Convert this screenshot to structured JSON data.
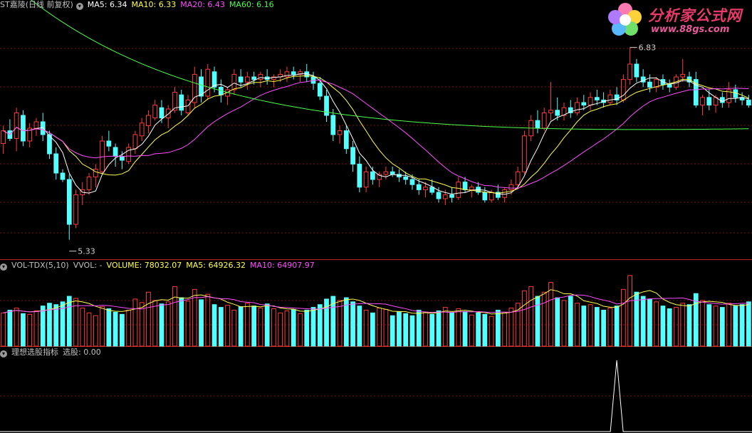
{
  "main_header": {
    "title": "ST嘉陵(日线 前复权)",
    "ma5": "MA5: 6.34",
    "ma10": "MA10: 6.33",
    "ma20": "MA20: 6.43",
    "ma60": "MA60: 6.16"
  },
  "vol_header": {
    "name": "VOL-TDX(5,10)",
    "vvol": "VVOL: -",
    "volume": "VOLUME: 78032.07",
    "ma5": "MA5: 64926.32",
    "ma10": "MA10: 64907.97"
  },
  "ind_header": {
    "name": "理想选股指标",
    "value": "选股: 0.00"
  },
  "logo": {
    "text": "分析家公式网",
    "url": "www.88gs.com"
  },
  "colors": {
    "up": "#ff3b3b",
    "down": "#54ffff",
    "ma5": "#ffffff",
    "ma10": "#ffff4a",
    "ma20": "#ff4dff",
    "ma60": "#4aff4a",
    "grid": "#7a1414",
    "divider": "#c02020"
  },
  "chart_data": {
    "type": "candlestick",
    "price_range": [
      5.2,
      7.1
    ],
    "high_label": "6.83",
    "low_label": "5.33",
    "ohlc": [
      [
        6.08,
        6.22,
        6.0,
        6.18
      ],
      [
        6.18,
        6.27,
        6.1,
        6.12
      ],
      [
        6.12,
        6.36,
        6.02,
        6.32
      ],
      [
        6.3,
        6.34,
        6.06,
        6.1
      ],
      [
        6.1,
        6.24,
        6.05,
        6.2
      ],
      [
        6.2,
        6.28,
        6.14,
        6.25
      ],
      [
        6.25,
        6.32,
        6.1,
        6.15
      ],
      [
        6.15,
        6.18,
        5.96,
        6.0
      ],
      [
        6.0,
        6.05,
        5.8,
        5.85
      ],
      [
        5.85,
        5.88,
        5.78,
        5.8
      ],
      [
        5.8,
        5.84,
        5.33,
        5.45
      ],
      [
        5.45,
        5.72,
        5.42,
        5.68
      ],
      [
        5.68,
        5.78,
        5.6,
        5.72
      ],
      [
        5.72,
        5.85,
        5.68,
        5.82
      ],
      [
        5.82,
        5.92,
        5.74,
        5.88
      ],
      [
        5.86,
        6.14,
        5.84,
        6.1
      ],
      [
        6.1,
        6.18,
        6.02,
        6.06
      ],
      [
        6.05,
        6.08,
        5.9,
        5.98
      ],
      [
        5.98,
        6.02,
        5.88,
        5.95
      ],
      [
        5.94,
        6.08,
        5.92,
        6.05
      ],
      [
        6.04,
        6.18,
        6.0,
        6.15
      ],
      [
        6.14,
        6.28,
        6.1,
        6.24
      ],
      [
        6.22,
        6.34,
        6.16,
        6.3
      ],
      [
        6.28,
        6.42,
        6.26,
        6.38
      ],
      [
        6.36,
        6.42,
        6.24,
        6.28
      ],
      [
        6.28,
        6.38,
        6.2,
        6.35
      ],
      [
        6.34,
        6.52,
        6.32,
        6.48
      ],
      [
        6.46,
        6.5,
        6.3,
        6.34
      ],
      [
        6.32,
        6.46,
        6.3,
        6.42
      ],
      [
        6.4,
        6.68,
        6.36,
        6.62
      ],
      [
        6.6,
        6.66,
        6.4,
        6.45
      ],
      [
        6.45,
        6.7,
        6.42,
        6.66
      ],
      [
        6.64,
        6.68,
        6.48,
        6.52
      ],
      [
        6.52,
        6.58,
        6.4,
        6.46
      ],
      [
        6.45,
        6.52,
        6.38,
        6.5
      ],
      [
        6.5,
        6.66,
        6.46,
        6.62
      ],
      [
        6.6,
        6.66,
        6.52,
        6.56
      ],
      [
        6.56,
        6.64,
        6.5,
        6.6
      ],
      [
        6.6,
        6.64,
        6.54,
        6.58
      ],
      [
        6.58,
        6.64,
        6.52,
        6.62
      ],
      [
        6.6,
        6.66,
        6.54,
        6.58
      ],
      [
        6.58,
        6.62,
        6.52,
        6.6
      ],
      [
        6.6,
        6.66,
        6.56,
        6.62
      ],
      [
        6.6,
        6.68,
        6.56,
        6.64
      ],
      [
        6.64,
        6.68,
        6.58,
        6.62
      ],
      [
        6.62,
        6.66,
        6.56,
        6.64
      ],
      [
        6.64,
        6.7,
        6.56,
        6.6
      ],
      [
        6.6,
        6.64,
        6.5,
        6.55
      ],
      [
        6.55,
        6.6,
        6.42,
        6.45
      ],
      [
        6.45,
        6.5,
        6.25,
        6.3
      ],
      [
        6.3,
        6.35,
        6.1,
        6.15
      ],
      [
        6.15,
        6.22,
        6.08,
        6.18
      ],
      [
        6.18,
        6.22,
        6.0,
        6.04
      ],
      [
        6.05,
        6.1,
        5.86,
        5.92
      ],
      [
        5.92,
        5.98,
        5.7,
        5.74
      ],
      [
        5.74,
        5.9,
        5.7,
        5.86
      ],
      [
        5.86,
        5.9,
        5.76,
        5.8
      ],
      [
        5.8,
        5.86,
        5.74,
        5.84
      ],
      [
        5.84,
        5.9,
        5.8,
        5.86
      ],
      [
        5.86,
        5.9,
        5.82,
        5.84
      ],
      [
        5.84,
        5.88,
        5.78,
        5.82
      ],
      [
        5.82,
        5.86,
        5.76,
        5.8
      ],
      [
        5.8,
        5.84,
        5.72,
        5.76
      ],
      [
        5.76,
        5.8,
        5.68,
        5.72
      ],
      [
        5.72,
        5.78,
        5.66,
        5.74
      ],
      [
        5.74,
        5.8,
        5.68,
        5.7
      ],
      [
        5.7,
        5.74,
        5.62,
        5.65
      ],
      [
        5.65,
        5.72,
        5.6,
        5.68
      ],
      [
        5.68,
        5.74,
        5.62,
        5.66
      ],
      [
        5.66,
        5.82,
        5.64,
        5.78
      ],
      [
        5.78,
        5.82,
        5.7,
        5.72
      ],
      [
        5.72,
        5.76,
        5.66,
        5.74
      ],
      [
        5.74,
        5.78,
        5.68,
        5.7
      ],
      [
        5.7,
        5.74,
        5.62,
        5.64
      ],
      [
        5.64,
        5.72,
        5.62,
        5.7
      ],
      [
        5.7,
        5.76,
        5.64,
        5.66
      ],
      [
        5.66,
        5.74,
        5.62,
        5.72
      ],
      [
        5.72,
        5.8,
        5.68,
        5.76
      ],
      [
        5.76,
        5.9,
        5.74,
        5.86
      ],
      [
        5.86,
        6.18,
        5.84,
        6.14
      ],
      [
        6.14,
        6.3,
        6.1,
        6.26
      ],
      [
        6.26,
        6.34,
        6.16,
        6.2
      ],
      [
        6.2,
        6.36,
        6.18,
        6.32
      ],
      [
        6.32,
        6.56,
        6.26,
        6.34
      ],
      [
        6.34,
        6.44,
        6.26,
        6.3
      ],
      [
        6.3,
        6.4,
        6.26,
        6.36
      ],
      [
        6.36,
        6.42,
        6.28,
        6.32
      ],
      [
        6.32,
        6.44,
        6.3,
        6.4
      ],
      [
        6.4,
        6.46,
        6.34,
        6.38
      ],
      [
        6.38,
        6.48,
        6.34,
        6.44
      ],
      [
        6.44,
        6.5,
        6.38,
        6.42
      ],
      [
        6.42,
        6.48,
        6.36,
        6.4
      ],
      [
        6.4,
        6.5,
        6.38,
        6.46
      ],
      [
        6.46,
        6.52,
        6.38,
        6.42
      ],
      [
        6.42,
        6.62,
        6.4,
        6.58
      ],
      [
        6.58,
        6.83,
        6.54,
        6.7
      ],
      [
        6.7,
        6.74,
        6.56,
        6.6
      ],
      [
        6.6,
        6.66,
        6.52,
        6.56
      ],
      [
        6.56,
        6.62,
        6.48,
        6.52
      ],
      [
        6.52,
        6.6,
        6.48,
        6.58
      ],
      [
        6.58,
        6.62,
        6.5,
        6.54
      ],
      [
        6.54,
        6.58,
        6.48,
        6.52
      ],
      [
        6.52,
        6.62,
        6.5,
        6.6
      ],
      [
        6.6,
        6.74,
        6.56,
        6.62
      ],
      [
        6.6,
        6.64,
        6.52,
        6.56
      ],
      [
        6.58,
        6.64,
        6.36,
        6.38
      ],
      [
        6.38,
        6.46,
        6.3,
        6.44
      ],
      [
        6.44,
        6.5,
        6.34,
        6.38
      ],
      [
        6.38,
        6.46,
        6.32,
        6.44
      ],
      [
        6.44,
        6.48,
        6.36,
        6.4
      ],
      [
        6.4,
        6.56,
        6.36,
        6.5
      ],
      [
        6.5,
        6.54,
        6.4,
        6.44
      ],
      [
        6.44,
        6.48,
        6.38,
        6.42
      ],
      [
        6.42,
        6.46,
        6.36,
        6.38
      ]
    ],
    "volume": [
      48000,
      52000,
      55000,
      47000,
      46000,
      51000,
      58000,
      62000,
      60000,
      64000,
      72000,
      69000,
      55000,
      48000,
      44000,
      57000,
      54000,
      49000,
      46000,
      52000,
      68000,
      63000,
      78000,
      66000,
      61000,
      64000,
      86000,
      70000,
      65000,
      82000,
      67000,
      75000,
      60000,
      56000,
      59000,
      52000,
      57000,
      62000,
      58000,
      55000,
      61000,
      54000,
      48000,
      51000,
      53000,
      47000,
      52000,
      56000,
      60000,
      68000,
      72000,
      66000,
      70000,
      64000,
      58000,
      52000,
      48000,
      55000,
      53000,
      44000,
      50000,
      47000,
      44000,
      52000,
      49000,
      46000,
      51000,
      56000,
      48000,
      54000,
      50000,
      45000,
      48000,
      46000,
      43000,
      52000,
      49000,
      55000,
      62000,
      80000,
      86000,
      72000,
      78000,
      92000,
      70000,
      66000,
      72000,
      62000,
      58000,
      60000,
      56000,
      52000,
      55000,
      58000,
      82000,
      102000,
      78000,
      72000,
      68000,
      64000,
      58000,
      54000,
      56000,
      62000,
      60000,
      76000,
      66000,
      60000,
      58000,
      56000,
      62000,
      58000,
      60000,
      64000
    ],
    "vol_range": [
      0,
      105000
    ],
    "signal_index": 93
  }
}
